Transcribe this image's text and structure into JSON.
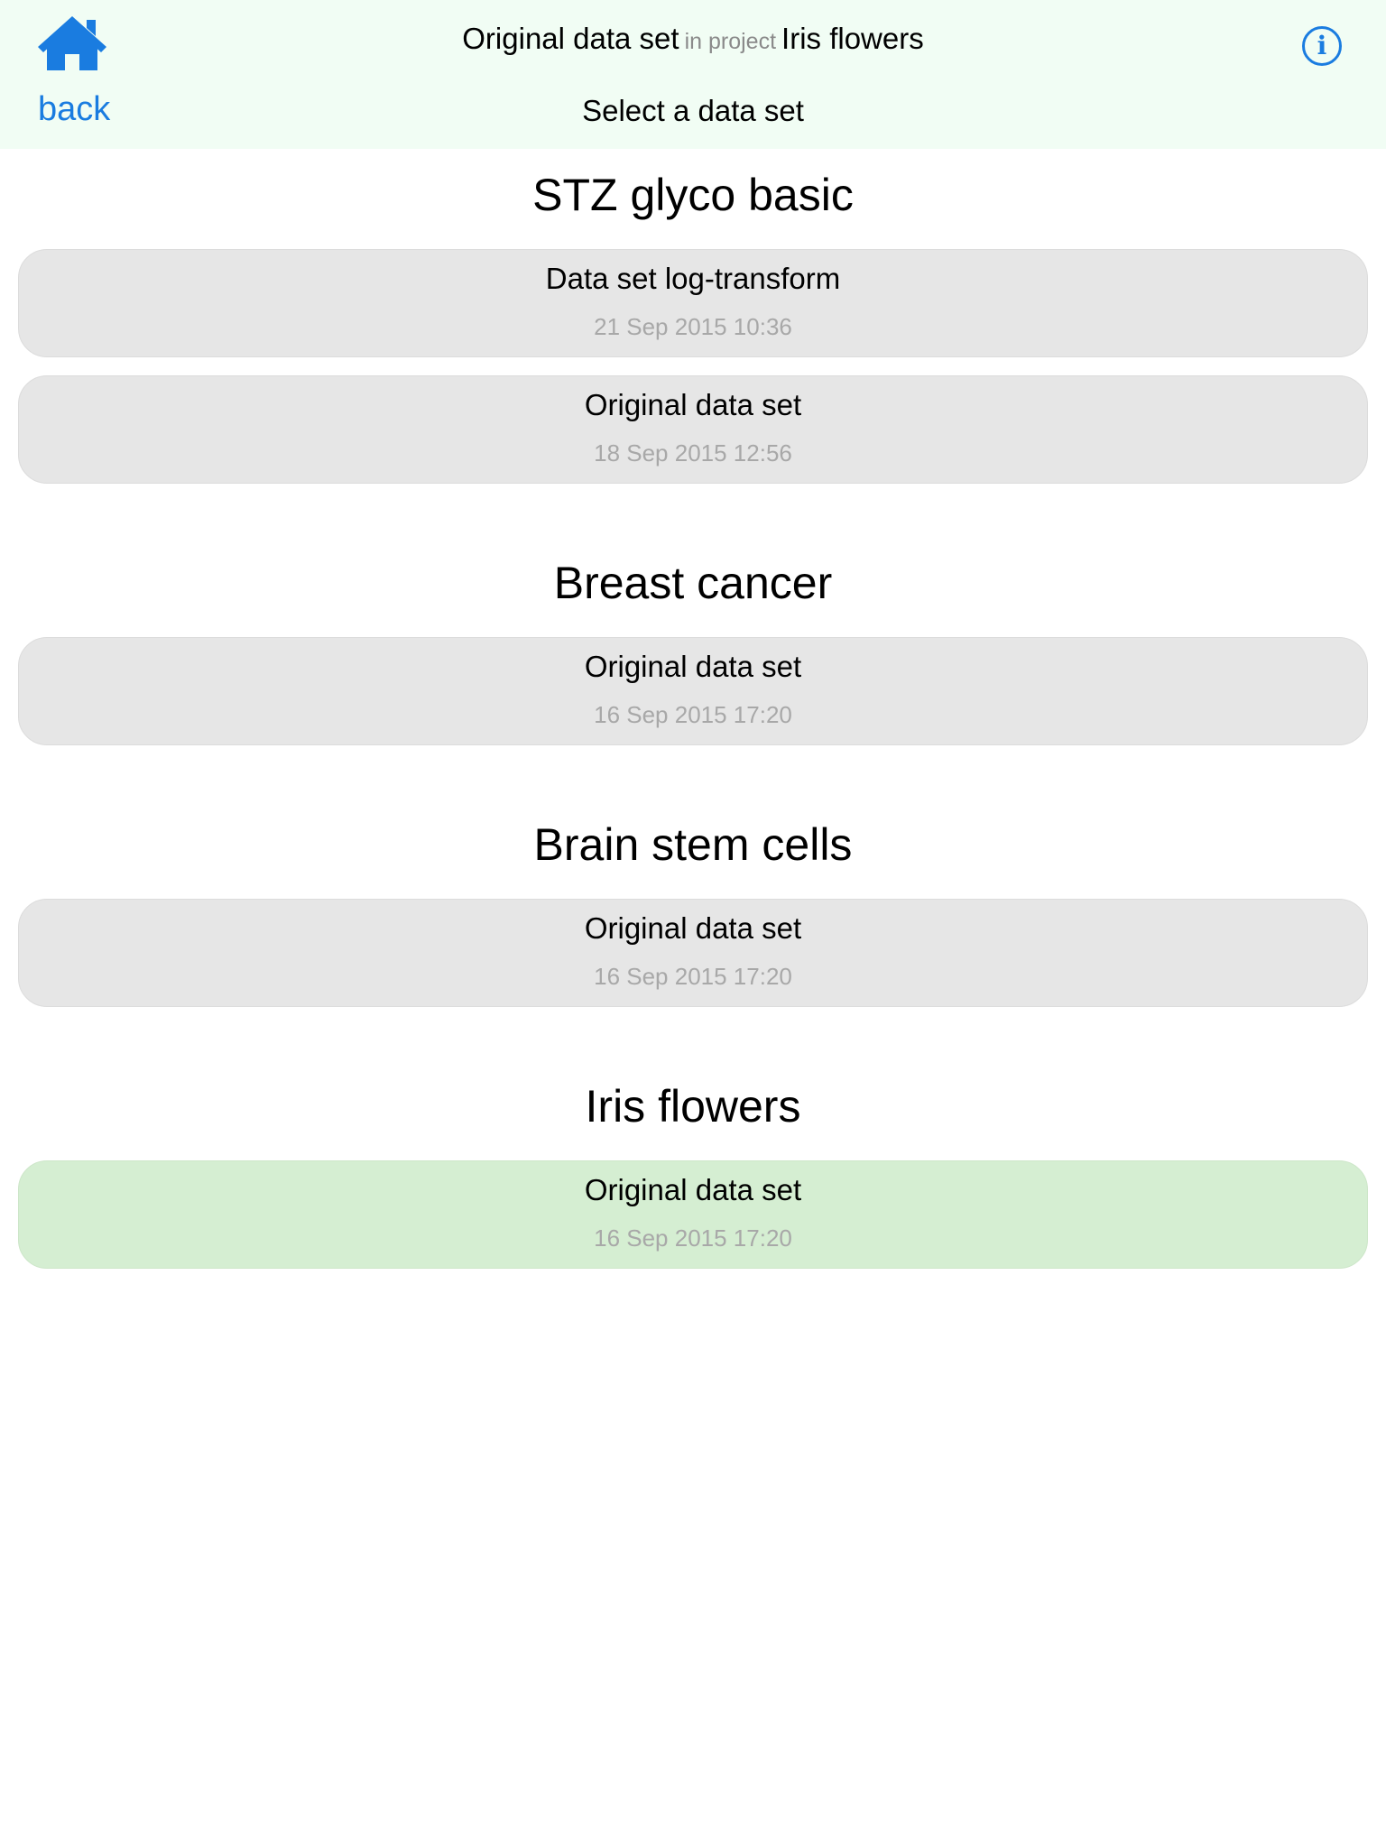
{
  "header": {
    "home_icon": "home-icon",
    "back_label": "back",
    "current_dataset": "Original data set",
    "in_project_label": "in project",
    "current_project": "Iris flowers",
    "subtitle": "Select a data set",
    "info_icon": "info-icon",
    "info_glyph": "i",
    "accent_color": "#1a7ce0",
    "background_color": "#f1fdf4"
  },
  "projects": [
    {
      "title": "STZ glyco basic",
      "datasets": [
        {
          "name": "Data set log-transform",
          "date": "21 Sep 2015 10:36",
          "selected": false
        },
        {
          "name": "Original data set",
          "date": "18 Sep 2015 12:56",
          "selected": false
        }
      ]
    },
    {
      "title": "Breast cancer",
      "datasets": [
        {
          "name": "Original data set",
          "date": "16 Sep 2015 17:20",
          "selected": false
        }
      ]
    },
    {
      "title": "Brain stem cells",
      "datasets": [
        {
          "name": "Original data set",
          "date": "16 Sep 2015 17:20",
          "selected": false
        }
      ]
    },
    {
      "title": "Iris flowers",
      "datasets": [
        {
          "name": "Original data set",
          "date": "16 Sep 2015 17:20",
          "selected": true
        }
      ]
    }
  ],
  "colors": {
    "card": "#e6e6e6",
    "card_selected": "#d5eed2",
    "date_text": "#a8a8a8"
  }
}
